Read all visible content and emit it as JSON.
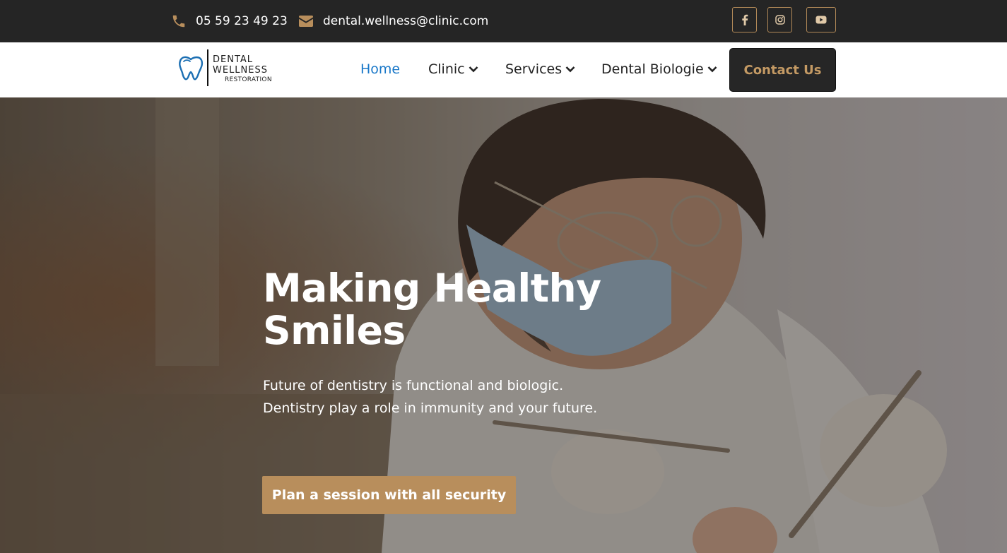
{
  "topbar": {
    "phone": "05 59 23 49 23",
    "email": "dental.wellness@clinic.com",
    "social": [
      {
        "icon": "facebook-icon"
      },
      {
        "icon": "instagram-icon"
      },
      {
        "icon": "youtube-icon"
      }
    ]
  },
  "logo": {
    "line1": "DENTAL",
    "line2": "WELLNESS",
    "line3": "RESTORATION"
  },
  "nav": {
    "items": [
      {
        "label": "Home",
        "active": true
      },
      {
        "label": "Clinic",
        "has_dropdown": true
      },
      {
        "label": "Services",
        "has_dropdown": true
      },
      {
        "label": "Dental Biologie",
        "has_dropdown": true
      }
    ],
    "contact_label": "Contact Us"
  },
  "hero": {
    "title": "Making Healthy Smiles",
    "subtitle_line1": "Future of dentistry is functional and biologic.",
    "subtitle_line2": "Dentistry play a role in immunity and your future.",
    "cta_label": "Plan a session with all security"
  },
  "colors": {
    "topbar_bg": "#252525",
    "accent_gold": "#b88e5c",
    "nav_active": "#1877c8",
    "contact_button_bg": "#262626"
  }
}
